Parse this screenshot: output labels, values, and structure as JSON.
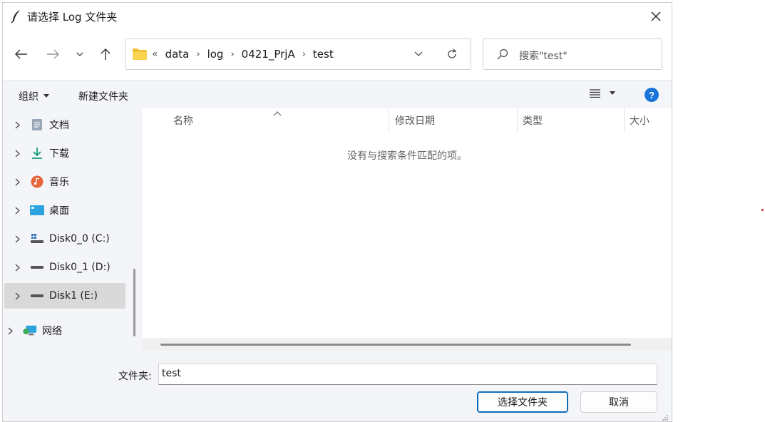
{
  "window": {
    "title": "请选择 Log 文件夹"
  },
  "address": {
    "lead": "«",
    "crumbs": [
      "data",
      "log",
      "0421_PrjA",
      "test"
    ]
  },
  "search": {
    "placeholder": "搜索\"test\""
  },
  "toolbar": {
    "organize_label": "组织",
    "new_folder_label": "新建文件夹"
  },
  "nav": {
    "items": [
      {
        "label": "文档",
        "icon": "documents-icon"
      },
      {
        "label": "下载",
        "icon": "downloads-icon"
      },
      {
        "label": "音乐",
        "icon": "music-icon"
      },
      {
        "label": "桌面",
        "icon": "desktop-icon"
      },
      {
        "label": "Disk0_0 (C:)",
        "icon": "system-drive-icon"
      },
      {
        "label": "Disk0_1 (D:)",
        "icon": "drive-icon"
      },
      {
        "label": "Disk1 (E:)",
        "icon": "drive-icon",
        "selected": true
      },
      {
        "label": "网络",
        "icon": "network-icon"
      }
    ]
  },
  "filelist": {
    "columns": [
      "名称",
      "修改日期",
      "类型",
      "大小"
    ],
    "sorted_by": "名称",
    "empty_message": "没有与搜索条件匹配的项。"
  },
  "footer": {
    "folder_label": "文件夹:",
    "folder_value": "test",
    "select_button": "选择文件夹",
    "cancel_button": "取消"
  },
  "colors": {
    "accent": "#0f6cbd",
    "help": "#1a73d9",
    "pane_bg": "#f3f5f8",
    "selected_bg": "#d9d9d9"
  }
}
